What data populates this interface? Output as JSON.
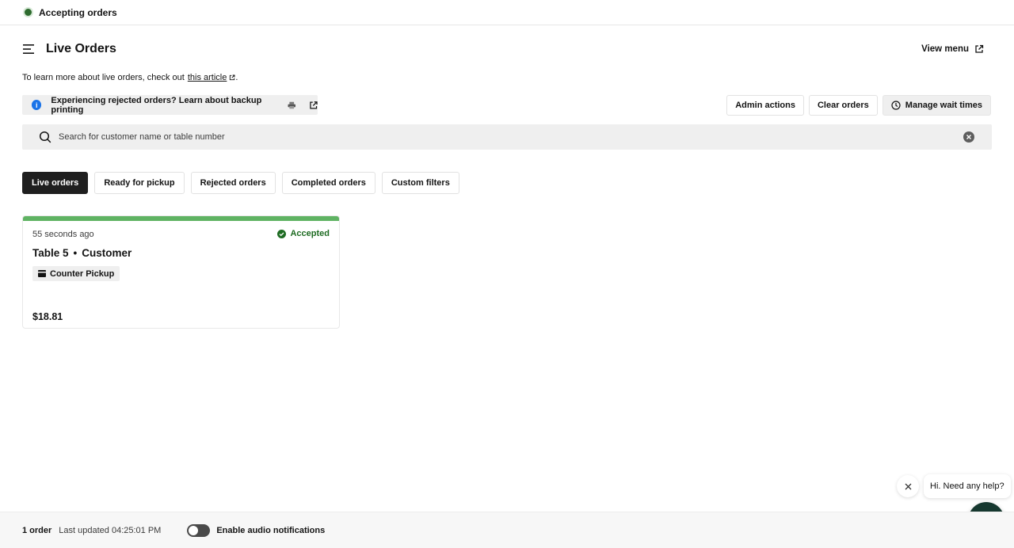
{
  "status": {
    "label": "Accepting orders",
    "color": "#2e6b2f"
  },
  "header": {
    "title": "Live Orders",
    "view_menu": "View menu",
    "learn_prefix": "To learn more about live orders, check out",
    "learn_link": "this article",
    "learn_suffix": "."
  },
  "notice": {
    "text": "Experiencing rejected orders? Learn about backup printing",
    "icons": [
      "info-icon",
      "printer-icon",
      "external-link-icon"
    ]
  },
  "actions": {
    "admin": "Admin actions",
    "clear": "Clear orders",
    "wait_times": "Manage wait times"
  },
  "search": {
    "placeholder": "Search for customer name or table number",
    "value": ""
  },
  "tabs": [
    {
      "label": "Live orders",
      "active": true
    },
    {
      "label": "Ready for pickup",
      "active": false
    },
    {
      "label": "Rejected orders",
      "active": false
    },
    {
      "label": "Completed orders",
      "active": false
    },
    {
      "label": "Custom filters",
      "active": false
    }
  ],
  "orders": [
    {
      "time_ago": "55 seconds ago",
      "status": "Accepted",
      "table": "Table 5",
      "separator": "•",
      "customer": "Customer",
      "pickup": "Counter Pickup",
      "total": "$18.81",
      "accent_color": "#5fb363"
    }
  ],
  "chat": {
    "greeting": "Hi. Need any help?",
    "brand_color": "#16382f"
  },
  "footer": {
    "order_count": "1 order",
    "last_updated": "Last updated 04:25:01 PM",
    "audio_label": "Enable audio notifications",
    "audio_enabled": false
  }
}
